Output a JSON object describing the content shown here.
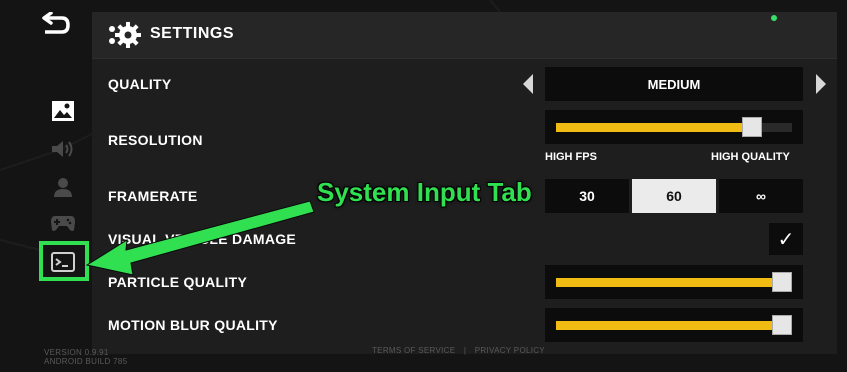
{
  "header": {
    "title": "SETTINGS",
    "back_icon": "back-arrow-icon",
    "settings_icon": "gear-icon"
  },
  "sidebar": {
    "items": [
      {
        "name": "graphics",
        "icon": "image-icon",
        "active": true
      },
      {
        "name": "audio",
        "icon": "speaker-icon",
        "active": false
      },
      {
        "name": "account",
        "icon": "person-icon",
        "active": false
      },
      {
        "name": "controls",
        "icon": "gamepad-icon",
        "active": false
      },
      {
        "name": "system-input",
        "icon": "terminal-icon",
        "active": false
      }
    ]
  },
  "settings": {
    "quality": {
      "label": "QUALITY",
      "value": "MEDIUM"
    },
    "resolution": {
      "label": "RESOLUTION",
      "min_label": "HIGH FPS",
      "max_label": "HIGH QUALITY",
      "level": 0.83
    },
    "framerate": {
      "label": "FRAMERATE",
      "options": [
        "30",
        "60",
        "∞"
      ],
      "selected": "60"
    },
    "vehicle_damage": {
      "label": "VISUAL VEHICLE DAMAGE",
      "checked": true,
      "check_glyph": "✓"
    },
    "particle_quality": {
      "label": "PARTICLE QUALITY",
      "level": 1.0
    },
    "motion_blur": {
      "label": "MOTION BLUR QUALITY",
      "level": 1.0
    }
  },
  "footer": {
    "version": "VERSION 0.9.91",
    "build": "ANDROID BUILD 785",
    "terms": "TERMS OF SERVICE",
    "separator": "|",
    "privacy": "PRIVACY POLICY"
  },
  "annotation": {
    "text": "System Input Tab"
  },
  "colors": {
    "accent": "#f0bc14",
    "highlight": "#30e050",
    "background": "#141414",
    "panel": "#1e1e1e"
  }
}
